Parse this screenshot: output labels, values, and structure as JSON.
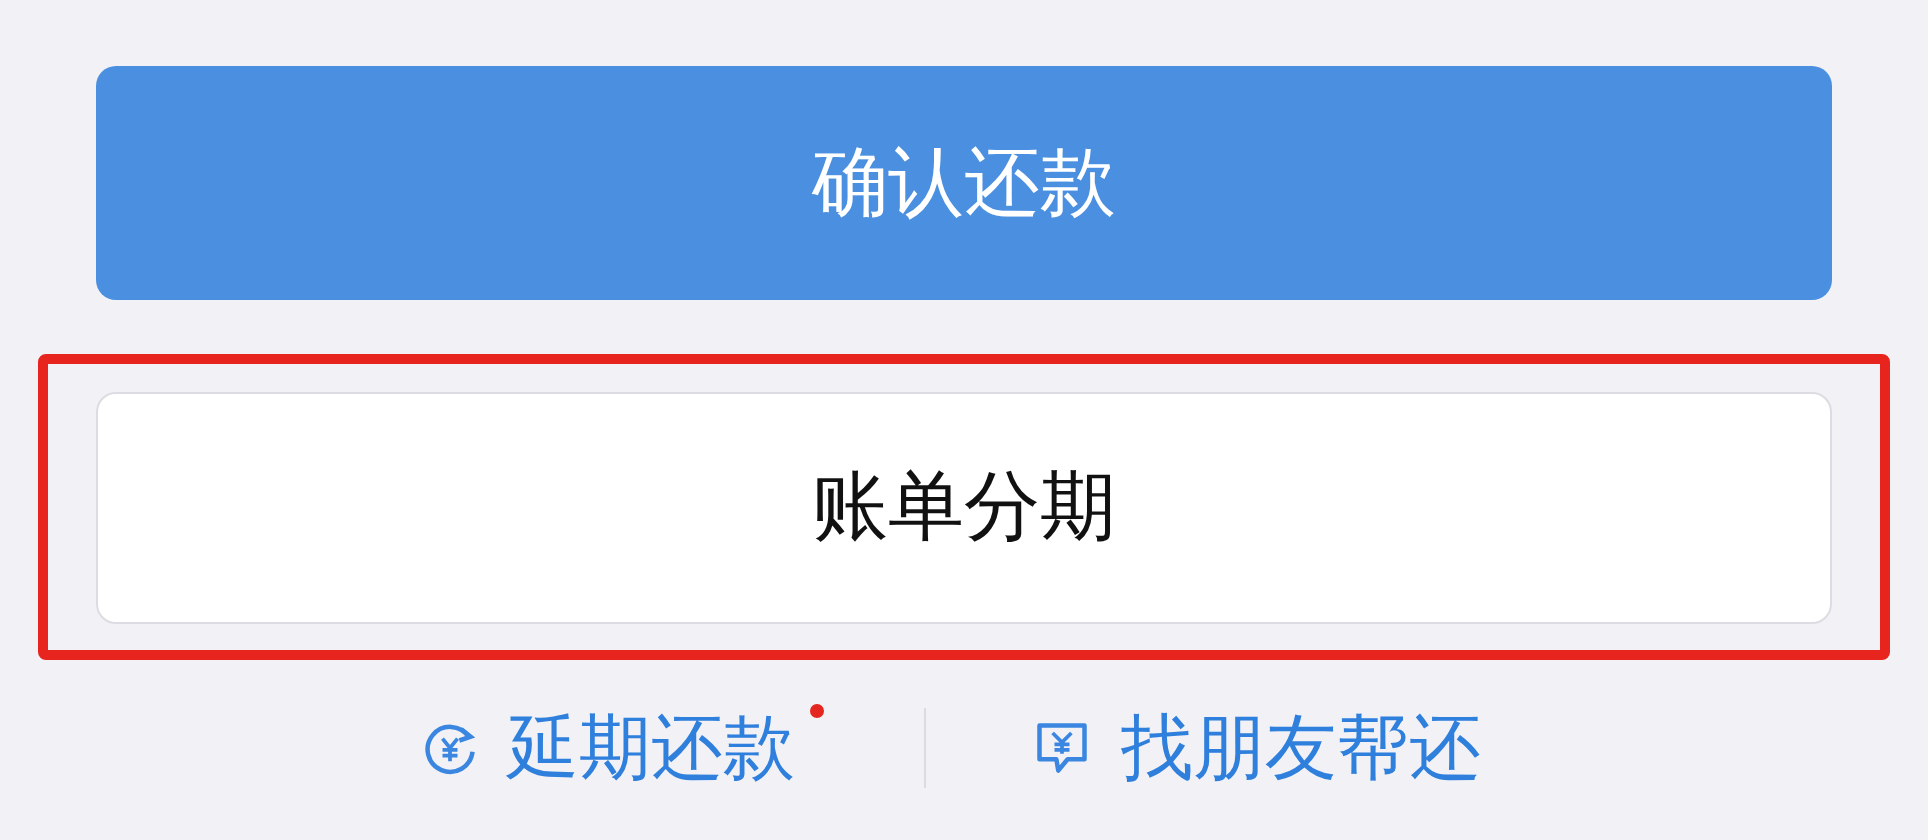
{
  "primary_button": {
    "label": "确认还款"
  },
  "secondary_button": {
    "label": "账单分期",
    "highlighted": true
  },
  "links": [
    {
      "kind": "extend",
      "label": "延期还款",
      "badge": true
    },
    {
      "kind": "friend",
      "label": "找朋友帮还",
      "badge": false
    }
  ]
}
